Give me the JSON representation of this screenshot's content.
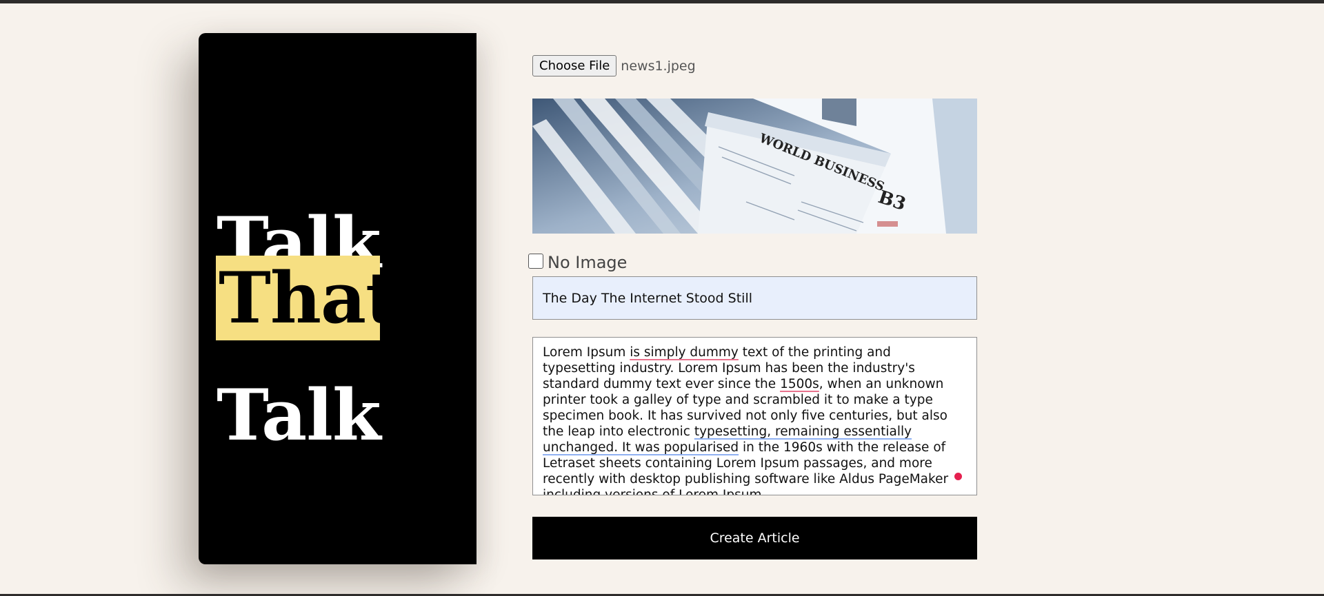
{
  "brand": {
    "line1": "Talk",
    "line2": "That",
    "line3": "Talk",
    "highlight_color": "#f6df82"
  },
  "file_picker": {
    "button_label": "Choose File",
    "file_name": "news1.jpeg"
  },
  "no_image": {
    "label": "No Image",
    "checked": false
  },
  "title_input": {
    "value": "The Day The Internet Stood Still"
  },
  "body_textarea": {
    "segments": [
      "Lorem Ipsum ",
      "is simply dummy",
      " text of the printing and typesetting industry. Lorem Ipsum has been the industry's standard dummy text ever since the ",
      "1500s",
      ", when an unknown printer took a galley of type and scrambled it to make a type specimen book. It has survived not only five centuries, but also the leap into electronic ",
      "typesetting, remaining essentially unchanged. It was popularised",
      " in the 1960s with the release of Letraset sheets containing Lorem Ipsum passages, and more recently with desktop publishing software like Aldus PageMaker including versions of Lorem Ipsum"
    ]
  },
  "create_button": {
    "label": "Create Article"
  }
}
